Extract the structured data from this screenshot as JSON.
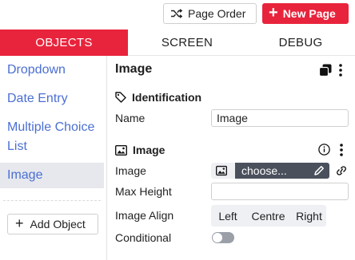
{
  "toolbar": {
    "page_order_label": "Page Order",
    "new_page_label": "New Page",
    "accent_color": "#e8243c"
  },
  "tabs": [
    {
      "label": "OBJECTS",
      "active": true
    },
    {
      "label": "SCREEN",
      "active": false
    },
    {
      "label": "DEBUG",
      "active": false
    }
  ],
  "sidebar": {
    "items": [
      {
        "label": "Dropdown"
      },
      {
        "label": "Date Entry"
      },
      {
        "label": "Multiple Choice List"
      },
      {
        "label": "Image",
        "active": true
      }
    ],
    "add_object_label": "Add Object"
  },
  "panel": {
    "title": "Image",
    "identification": {
      "heading": "Identification",
      "name_label": "Name",
      "name_value": "Image"
    },
    "image_section": {
      "heading": "Image",
      "image_label": "Image",
      "choose_label": "choose...",
      "max_height_label": "Max Height",
      "max_height_value": "",
      "image_align_label": "Image Align",
      "align_options": [
        "Left",
        "Centre",
        "Right"
      ],
      "conditional_label": "Conditional",
      "conditional_on": false
    }
  },
  "icons": {
    "page_order": "shuffle-icon",
    "new_page": "plus-icon",
    "add_object": "plus-icon",
    "copy": "copy-icon",
    "more": "more-vertical-icon",
    "identification": "tag-icon",
    "image_section": "image-icon",
    "info": "info-icon",
    "edit": "pencil-icon",
    "link": "link-icon"
  }
}
